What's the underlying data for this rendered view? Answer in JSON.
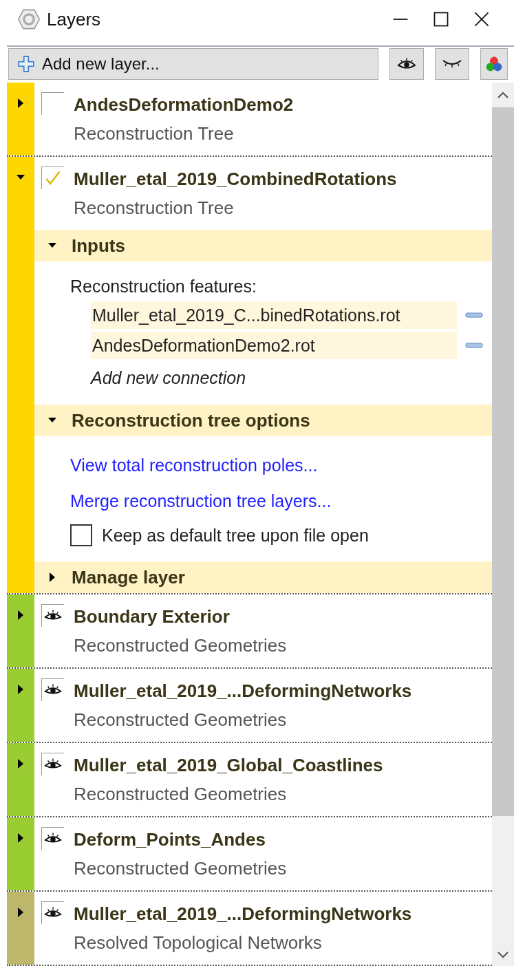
{
  "window": {
    "title": "Layers"
  },
  "toolbar": {
    "add_button": "Add new layer..."
  },
  "layers": [
    {
      "name": "AndesDeformationDemo2",
      "type": "Reconstruction Tree",
      "kind": "tree",
      "visible": false,
      "expanded": false,
      "color": "#ffd700"
    },
    {
      "name": "Muller_etal_2019_CombinedRotations",
      "type": "Reconstruction Tree",
      "kind": "tree",
      "visible": true,
      "expanded": true,
      "color": "#ffd700",
      "sections": [
        {
          "title": "Inputs",
          "expanded": true,
          "kind": "inputs",
          "label": "Reconstruction features:",
          "files": [
            "Muller_etal_2019_C...binedRotations.rot",
            "AndesDeformationDemo2.rot"
          ],
          "add_link": "Add new connection"
        },
        {
          "title": "Reconstruction tree options",
          "expanded": true,
          "kind": "options",
          "links": [
            "View total reconstruction poles...",
            "Merge reconstruction tree layers..."
          ],
          "checkbox": {
            "label": "Keep as default tree upon file open",
            "checked": false
          }
        },
        {
          "title": "Manage layer",
          "expanded": false
        }
      ]
    },
    {
      "name": "Boundary Exterior",
      "type": "Reconstructed Geometries",
      "kind": "geometry",
      "visible": true,
      "expanded": false,
      "color": "#9acd32"
    },
    {
      "name": "Muller_etal_2019_...DeformingNetworks",
      "type": "Reconstructed Geometries",
      "kind": "geometry",
      "visible": true,
      "expanded": false,
      "color": "#9acd32"
    },
    {
      "name": "Muller_etal_2019_Global_Coastlines",
      "type": "Reconstructed Geometries",
      "kind": "geometry",
      "visible": true,
      "expanded": false,
      "color": "#9acd32"
    },
    {
      "name": "Deform_Points_Andes",
      "type": "Reconstructed Geometries",
      "kind": "geometry",
      "visible": true,
      "expanded": false,
      "color": "#9acd32"
    },
    {
      "name": "Muller_etal_2019_...DeformingNetworks",
      "type": "Resolved Topological Networks",
      "kind": "geometry",
      "visible": true,
      "expanded": false,
      "color": "#bdb76b"
    }
  ]
}
